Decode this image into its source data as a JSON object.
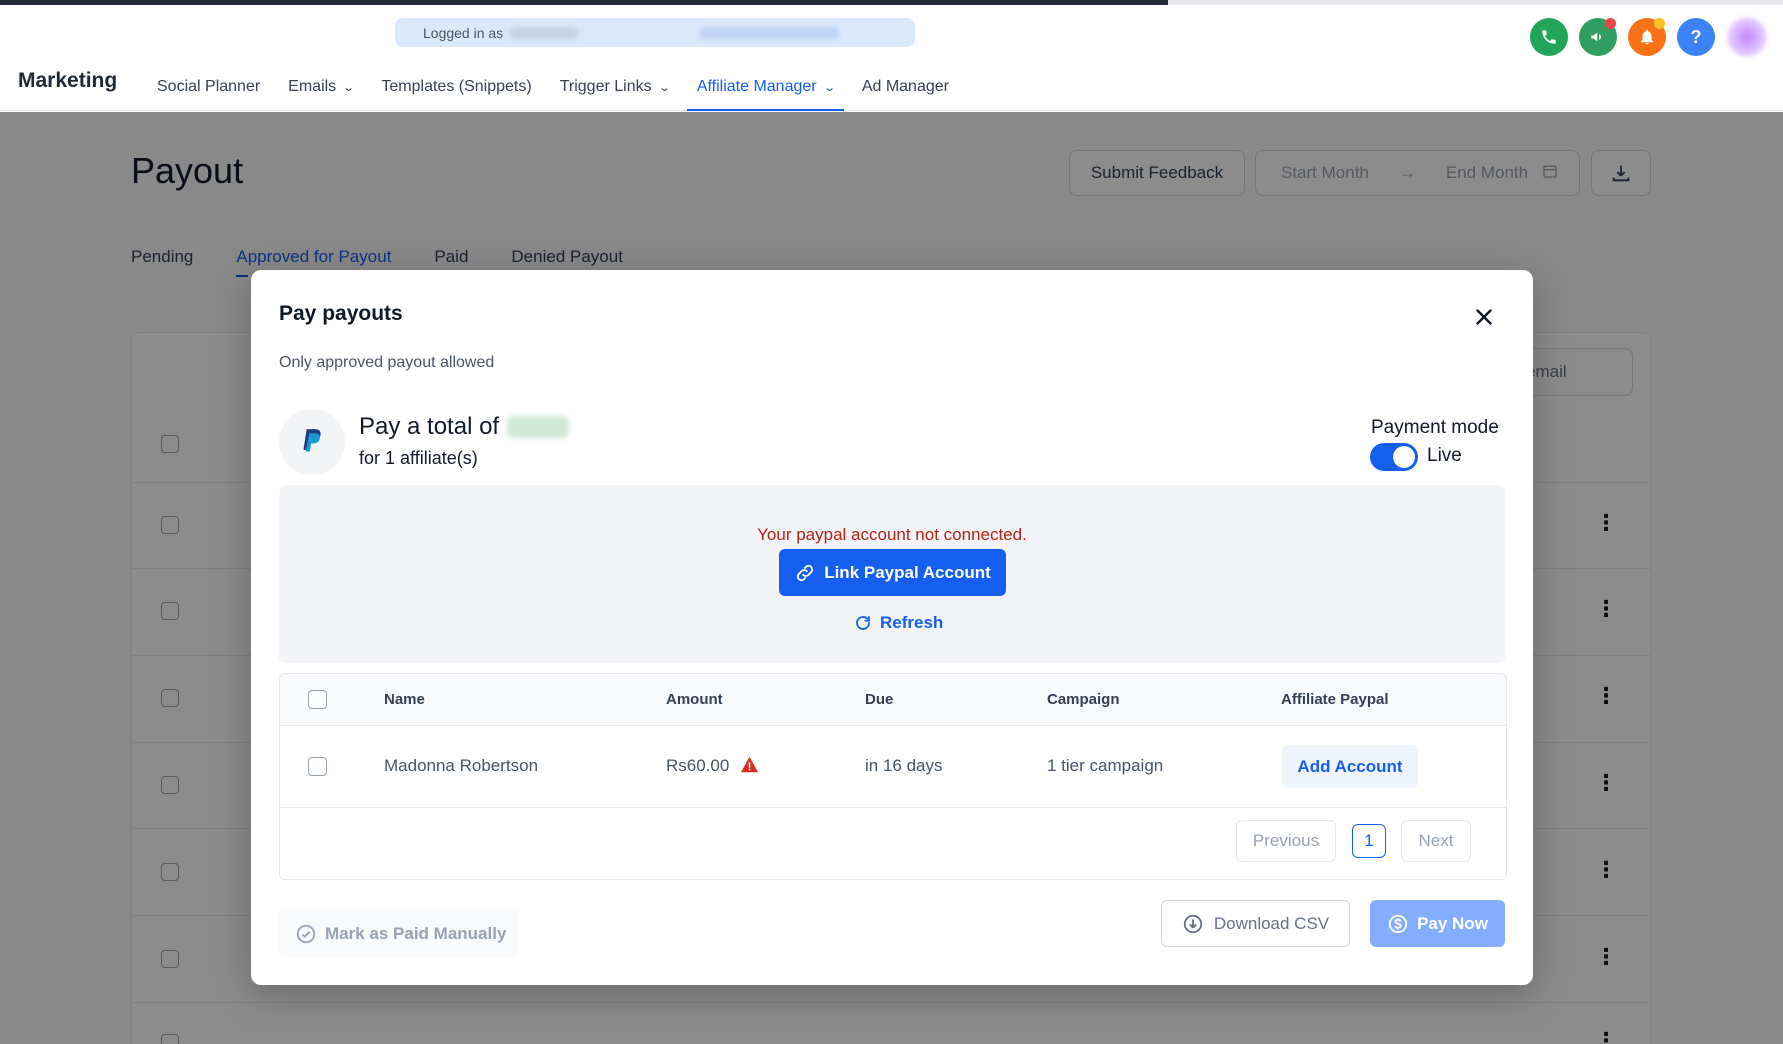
{
  "header": {
    "logged_in_label": "Logged in as",
    "brand": "Marketing",
    "nav": [
      {
        "label": "Social Planner"
      },
      {
        "label": "Emails",
        "has_dropdown": true
      },
      {
        "label": "Templates (Snippets)"
      },
      {
        "label": "Trigger Links",
        "has_dropdown": true
      },
      {
        "label": "Affiliate Manager",
        "has_dropdown": true,
        "active": true
      },
      {
        "label": "Ad Manager"
      }
    ],
    "icons": {
      "phone": {
        "name": "phone-icon",
        "color": "#22a55b"
      },
      "announce": {
        "name": "megaphone-icon",
        "color": "#2f9e60"
      },
      "notifications": {
        "name": "bell-icon",
        "color": "#f97316"
      },
      "help": {
        "name": "help-icon",
        "color": "#3b82f6",
        "glyph": "?"
      }
    }
  },
  "page": {
    "title": "Payout",
    "submit_feedback": "Submit Feedback",
    "start_month_placeholder": "Start Month",
    "end_month_placeholder": "End Month",
    "tabs": [
      {
        "label": "Pending"
      },
      {
        "label": "Approved for Payout",
        "active": true
      },
      {
        "label": "Paid"
      },
      {
        "label": "Denied Payout"
      }
    ],
    "search_fragment": "email"
  },
  "modal": {
    "title": "Pay payouts",
    "subtitle": "Only approved payout allowed",
    "total_prefix": "Pay a total of",
    "affiliates_text": "for 1 affiliate(s)",
    "payment_mode_label": "Payment mode",
    "payment_mode_value": "Live",
    "payment_mode_on": true,
    "notice_text": "Your paypal account not connected.",
    "link_button": "Link Paypal Account",
    "refresh_button": "Refresh",
    "table": {
      "columns": [
        "Name",
        "Amount",
        "Due",
        "Campaign",
        "Affiliate Paypal"
      ],
      "rows": [
        {
          "name": "Madonna Robertson",
          "amount": "Rs60.00",
          "due": "in 16 days",
          "campaign": "1 tier campaign",
          "action": "Add Account"
        }
      ]
    },
    "pagination": {
      "previous": "Previous",
      "current": "1",
      "next": "Next"
    },
    "mark_paid": "Mark as Paid Manually",
    "download_csv": "Download CSV",
    "pay_now": "Pay Now"
  },
  "colors": {
    "accent": "#155eef",
    "error": "#b42318",
    "warning_icon": "#d92d20"
  }
}
